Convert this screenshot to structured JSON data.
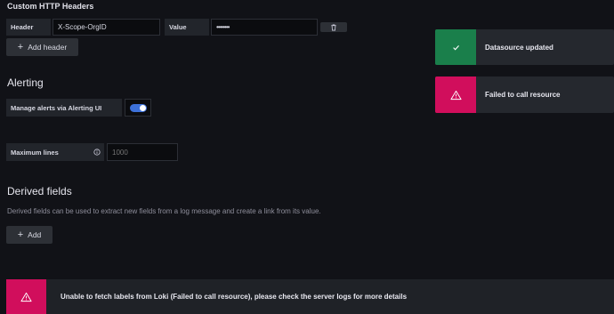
{
  "headers_section": {
    "title": "Custom HTTP Headers",
    "header_label": "Header",
    "header_value": "X-Scope-OrgID",
    "value_label": "Value",
    "value_masked": "••••••••",
    "add_header_label": "Add header"
  },
  "alerting": {
    "title": "Alerting",
    "manage_label": "Manage alerts via Alerting UI",
    "manage_enabled": true
  },
  "max_lines": {
    "label": "Maximum lines",
    "placeholder": "1000"
  },
  "derived_fields": {
    "title": "Derived fields",
    "description": "Derived fields can be used to extract new fields from a log message and create a link from its value.",
    "add_label": "Add"
  },
  "toasts": [
    {
      "status": "success",
      "message": "Datasource updated",
      "color": "#1a7f4b"
    },
    {
      "status": "error",
      "message": "Failed to call resource",
      "color": "#d10e5c"
    }
  ],
  "banner": {
    "status": "error",
    "message": "Unable to fetch labels from Loki (Failed to call resource), please check the server logs for more details",
    "color": "#d10e5c"
  }
}
